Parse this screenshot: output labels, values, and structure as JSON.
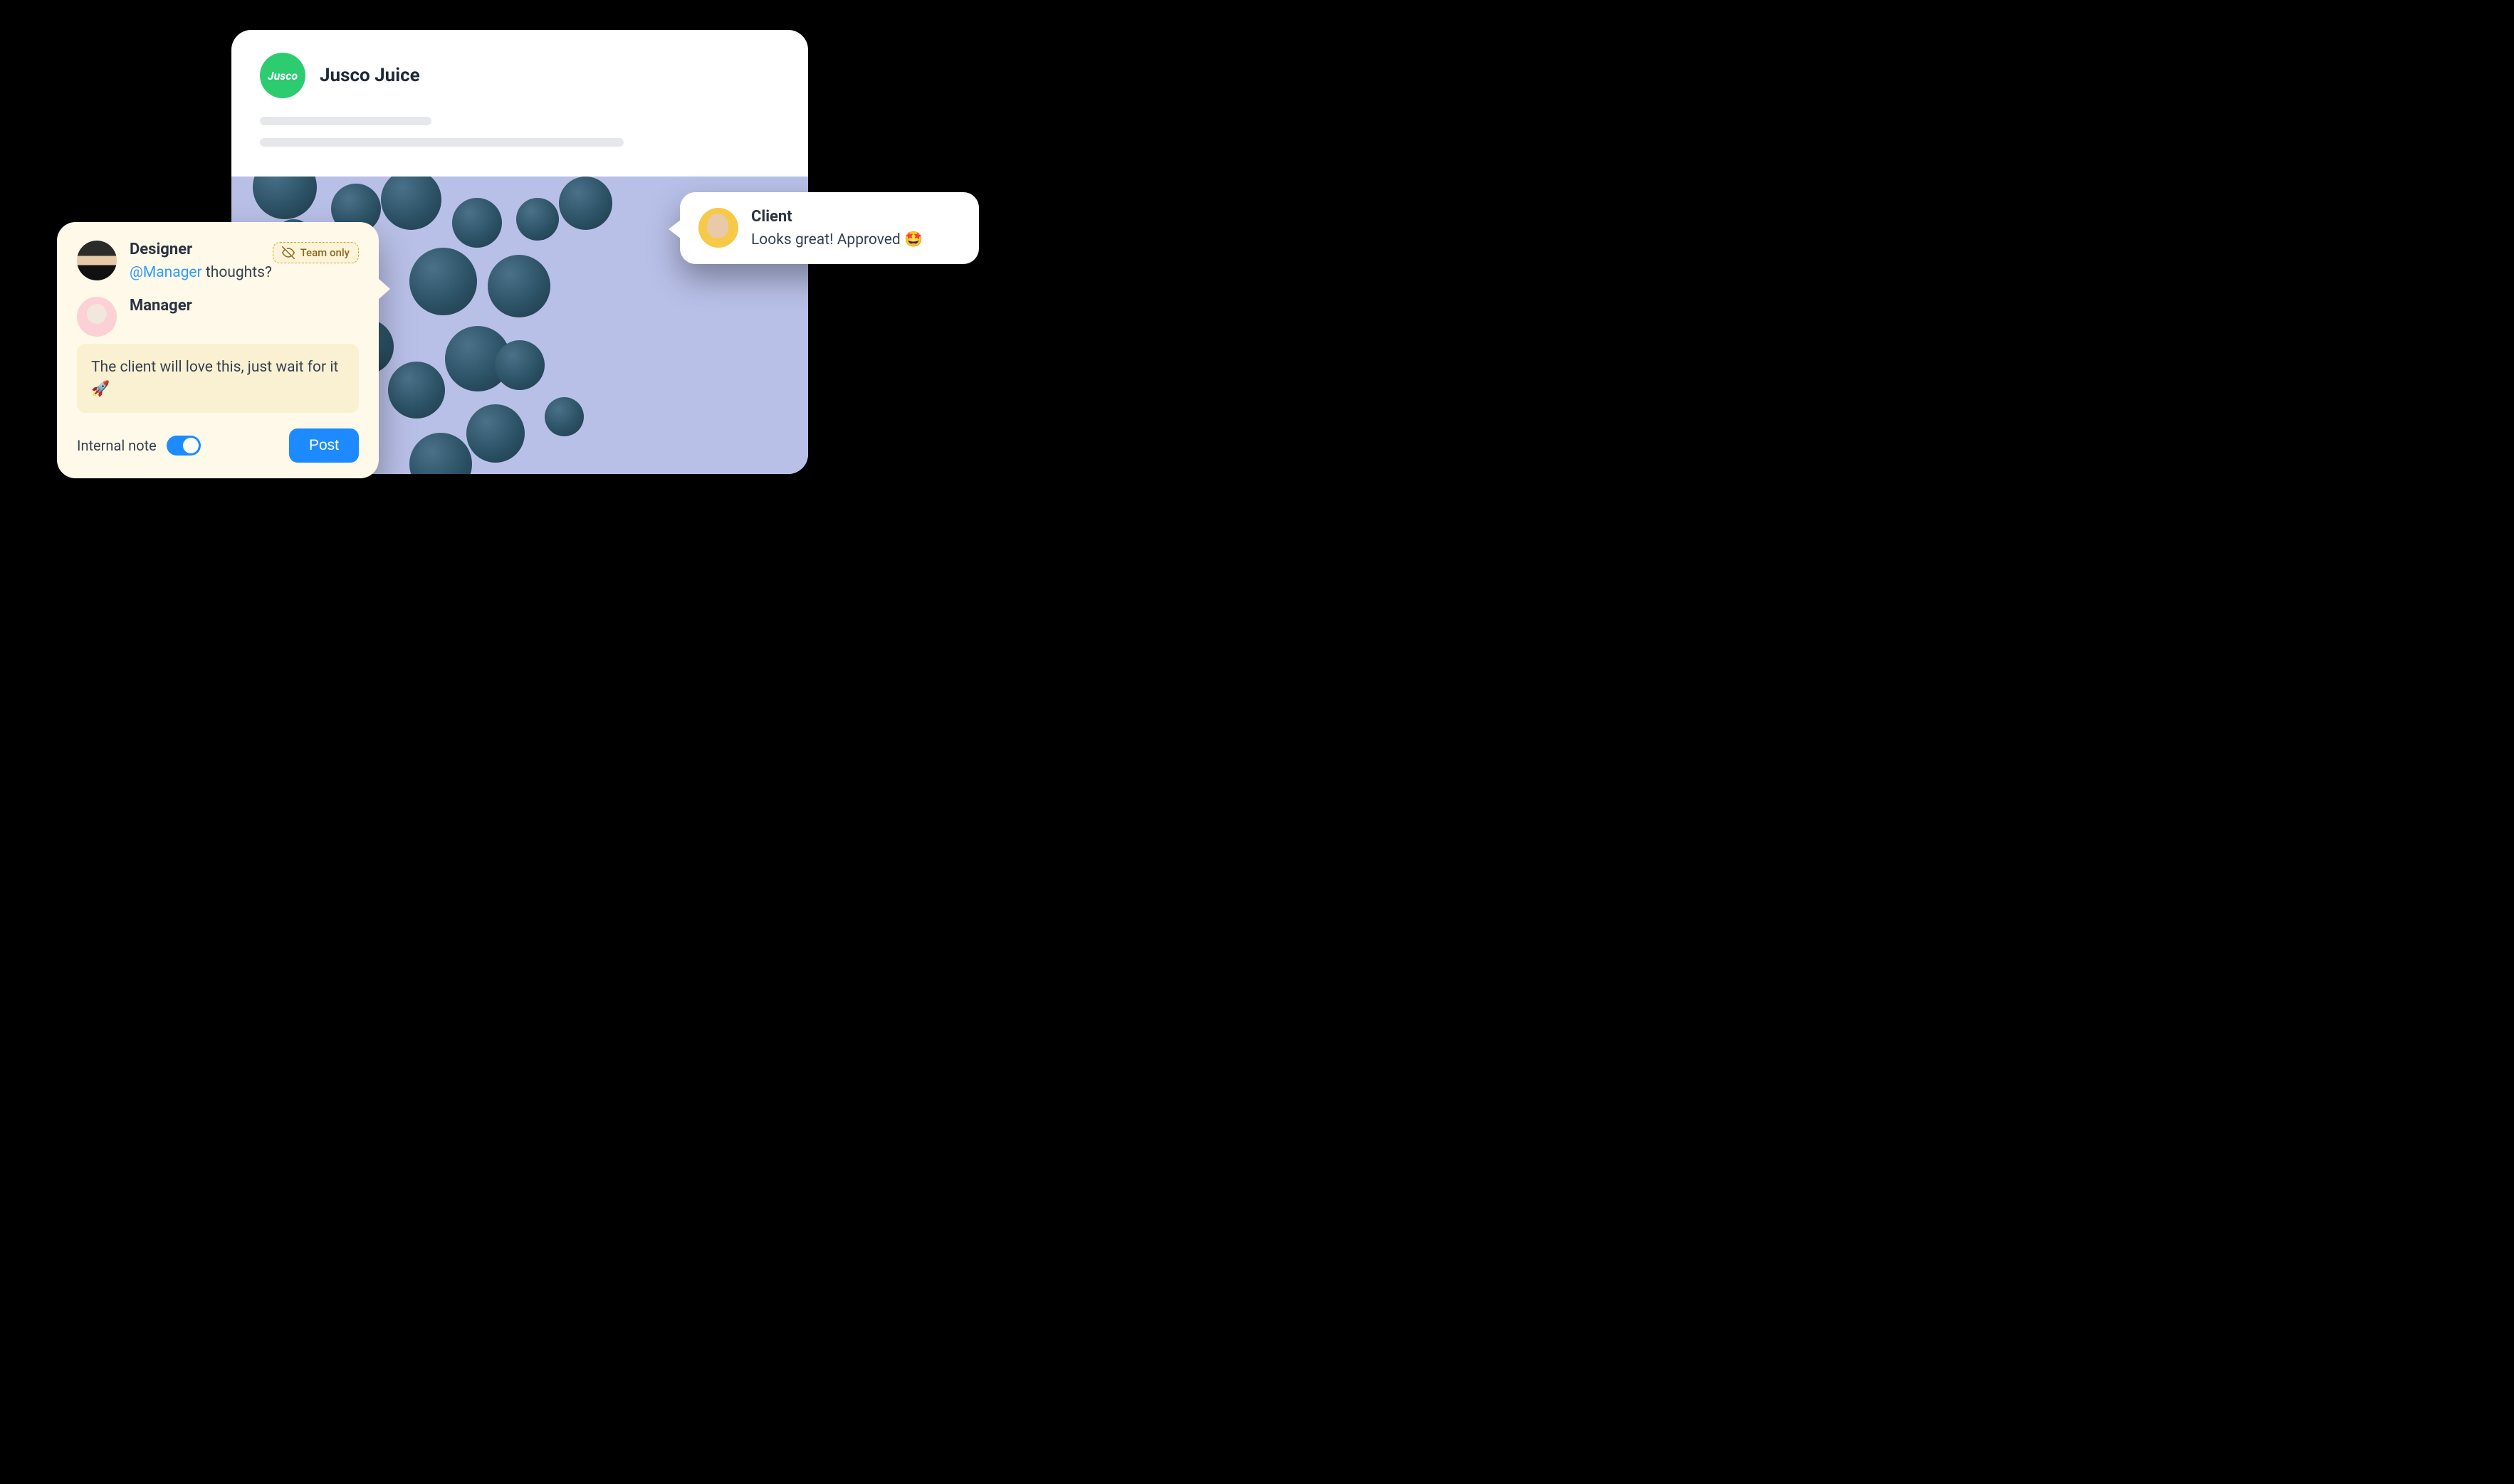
{
  "post": {
    "brand_name": "Jusco Juice",
    "brand_avatar_text": "Jusco"
  },
  "team_panel": {
    "badge_label": "Team only",
    "comments": [
      {
        "author": "Designer",
        "mention": "@Manager",
        "text_after_mention": " thoughts?"
      },
      {
        "author": "Manager"
      }
    ],
    "reply_draft": "The client will love this, just wait for it 🚀",
    "internal_note_label": "Internal note",
    "internal_note_on": true,
    "post_button_label": "Post"
  },
  "client_bubble": {
    "author": "Client",
    "text": "Looks great! Approved 🤩"
  }
}
